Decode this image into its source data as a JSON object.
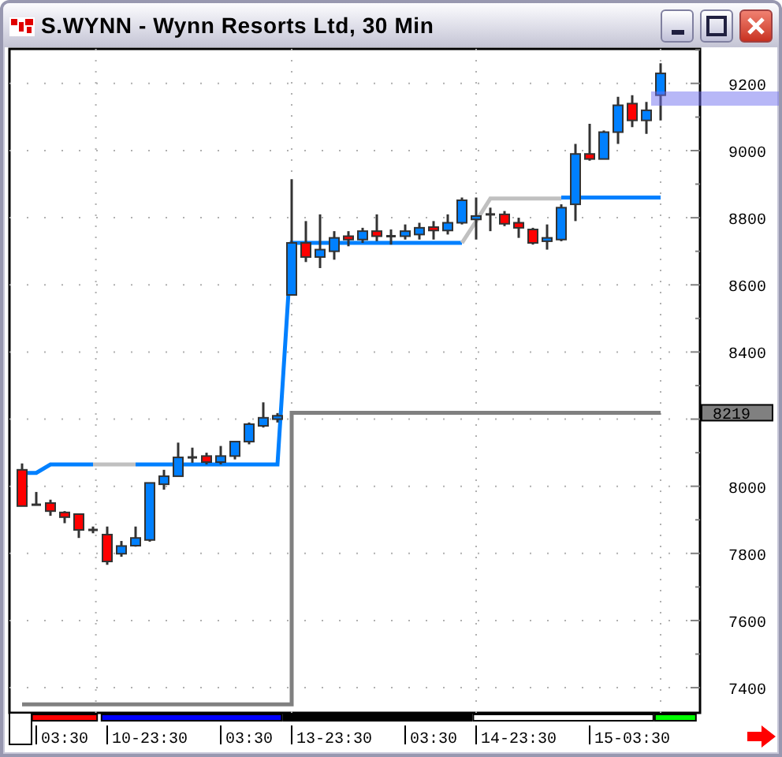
{
  "window": {
    "title": "S.WYNN - Wynn Resorts Ltd, 30 Min"
  },
  "chart": {
    "last_price": "8219",
    "sessions": [
      {
        "color": "#ff0000"
      },
      {
        "color": "#0000ff"
      },
      {
        "color": "#000000"
      },
      {
        "color": "#ffffff"
      },
      {
        "color": "#00ff00"
      }
    ],
    "chart_data": {
      "type": "candlestick",
      "categories": [
        null,
        null,
        null,
        "03:30",
        null,
        null,
        null,
        null,
        null,
        "10-23:30",
        null,
        null,
        null,
        null,
        null,
        null,
        "03:30",
        null,
        null,
        null,
        null,
        null,
        "13-23:30",
        null,
        null,
        null,
        null,
        null,
        null,
        "03:30",
        null,
        null,
        null,
        null,
        null,
        "14-23:30",
        null,
        null,
        null,
        null,
        null,
        null,
        null,
        "15-03:30",
        null,
        null
      ],
      "ylim": [
        7325,
        9303
      ],
      "yticks": [
        7400,
        7600,
        7800,
        8000,
        8400,
        8600,
        8800,
        9000,
        9200
      ],
      "grid": true,
      "series": [
        {
          "type": "line",
          "color": "#0080ff",
          "values": [
            8040,
            8040,
            8065,
            8065,
            8065,
            8065,
            null,
            null,
            8065,
            8065,
            8065,
            8065,
            8065,
            8065,
            8065,
            8065,
            8065,
            8065,
            8065,
            8725,
            8725,
            8725,
            8725,
            8725,
            8725,
            8725,
            8725,
            8725,
            8725,
            8725,
            8725,
            8725,
            null,
            null,
            null,
            null,
            null,
            null,
            8860,
            8860,
            8860,
            8860,
            8860,
            8860,
            8860,
            8860
          ]
        },
        {
          "type": "line",
          "color": "#c0c0c0",
          "values": [
            null,
            null,
            null,
            null,
            null,
            8065,
            8065,
            8065,
            8065,
            null,
            null,
            null,
            null,
            null,
            null,
            null,
            null,
            null,
            null,
            null,
            null,
            null,
            null,
            null,
            null,
            null,
            null,
            null,
            null,
            null,
            null,
            8725,
            8790,
            8857,
            8857,
            8857,
            8857,
            8857,
            8857,
            null,
            null,
            null,
            null,
            null,
            null,
            null
          ]
        },
        {
          "type": "step",
          "color": "#808080",
          "values": [
            7350,
            7350,
            7350,
            7350,
            7350,
            7350,
            7350,
            7350,
            7350,
            7350,
            7350,
            7350,
            7350,
            7350,
            7350,
            7350,
            7350,
            7350,
            7350,
            8219,
            8219,
            8219,
            8219,
            8219,
            8219,
            8219,
            8219,
            8219,
            8219,
            8219,
            8219,
            8219,
            8219,
            8219,
            8219,
            8219,
            8219,
            8219,
            8219,
            8219,
            8219,
            8219,
            8219,
            8219,
            8219,
            8219
          ]
        }
      ],
      "ohlc": [
        [
          8049,
          8068,
          7941,
          7941
        ],
        [
          7945,
          7983,
          7945,
          7945
        ],
        [
          7950,
          7960,
          7912,
          7926
        ],
        [
          7922,
          7926,
          7890,
          7908
        ],
        [
          7917,
          7917,
          7846,
          7870
        ],
        [
          7870,
          7880,
          7860,
          7870
        ],
        [
          7856,
          7880,
          7766,
          7776
        ],
        [
          7799,
          7837,
          7790,
          7822
        ],
        [
          7823,
          7880,
          7820,
          7846
        ],
        [
          7840,
          8010,
          7835,
          8010
        ],
        [
          8006,
          8049,
          7990,
          8030
        ],
        [
          8030,
          8130,
          8030,
          8086
        ],
        [
          8086,
          8115,
          8070,
          8086
        ],
        [
          8090,
          8100,
          8065,
          8072
        ],
        [
          8072,
          8120,
          8065,
          8090
        ],
        [
          8090,
          8133,
          8080,
          8133
        ],
        [
          8133,
          8190,
          8125,
          8185
        ],
        [
          8180,
          8250,
          8175,
          8204
        ],
        [
          8200,
          8218,
          8190,
          8210
        ],
        [
          8570,
          8915,
          8570,
          8725
        ],
        [
          8725,
          8790,
          8668,
          8683
        ],
        [
          8683,
          8810,
          8650,
          8705
        ],
        [
          8700,
          8760,
          8675,
          8740
        ],
        [
          8745,
          8760,
          8715,
          8735
        ],
        [
          8735,
          8770,
          8725,
          8760
        ],
        [
          8760,
          8810,
          8730,
          8745
        ],
        [
          8745,
          8765,
          8720,
          8745
        ],
        [
          8745,
          8780,
          8735,
          8760
        ],
        [
          8750,
          8785,
          8735,
          8770
        ],
        [
          8772,
          8790,
          8735,
          8762
        ],
        [
          8762,
          8810,
          8750,
          8785
        ],
        [
          8785,
          8860,
          8780,
          8852
        ],
        [
          8795,
          8860,
          8735,
          8805
        ],
        [
          8810,
          8830,
          8760,
          8810
        ],
        [
          8810,
          8820,
          8775,
          8782
        ],
        [
          8785,
          8800,
          8740,
          8770
        ],
        [
          8765,
          8770,
          8720,
          8725
        ],
        [
          8730,
          8780,
          8705,
          8740
        ],
        [
          8735,
          8840,
          8730,
          8830
        ],
        [
          8840,
          9020,
          8790,
          8990
        ],
        [
          8990,
          9080,
          8970,
          8975
        ],
        [
          8975,
          9060,
          8975,
          9055
        ],
        [
          9055,
          9160,
          9020,
          9135
        ],
        [
          9140,
          9165,
          9070,
          9090
        ],
        [
          9090,
          9145,
          9050,
          9120
        ],
        [
          9165,
          9260,
          9090,
          9230
        ]
      ]
    }
  }
}
